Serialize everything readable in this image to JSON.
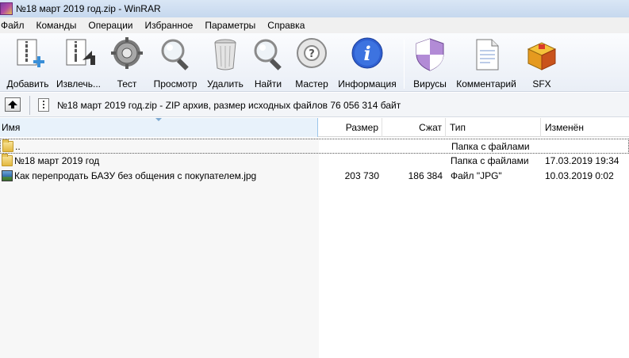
{
  "window": {
    "title": "№18 март 2019 год.zip - WinRAR"
  },
  "menu": [
    "Файл",
    "Команды",
    "Операции",
    "Избранное",
    "Параметры",
    "Справка"
  ],
  "toolbar": {
    "add": "Добавить",
    "extract": "Извлечь...",
    "test": "Тест",
    "view": "Просмотр",
    "delete": "Удалить",
    "find": "Найти",
    "wizard": "Мастер",
    "info": "Информация",
    "virus": "Вирусы",
    "comment": "Комментарий",
    "sfx": "SFX"
  },
  "address": {
    "text": "№18 март 2019 год.zip - ZIP архив, размер исходных файлов 76 056 314 байт"
  },
  "columns": {
    "name": "Имя",
    "size": "Размер",
    "packed": "Сжат",
    "type": "Тип",
    "modified": "Изменён"
  },
  "files": [
    {
      "name": "..",
      "size": "",
      "packed": "",
      "type": "Папка с файлами",
      "modified": "",
      "icon": "folder-icon"
    },
    {
      "name": "№18 март 2019 год",
      "size": "",
      "packed": "",
      "type": "Папка с файлами",
      "modified": "17.03.2019 19:34",
      "icon": "folder-icon"
    },
    {
      "name": "Как перепродать БАЗУ без общения с покупателем.jpg",
      "size": "203 730",
      "packed": "186 384",
      "type": "Файл \"JPG\"",
      "modified": "10.03.2019 0:02",
      "icon": "image-icon"
    }
  ],
  "colors": {
    "title_bar": "#c6d8ee",
    "selected_column_header": "#e8f2fb",
    "info_icon": "#2f5fd0"
  }
}
